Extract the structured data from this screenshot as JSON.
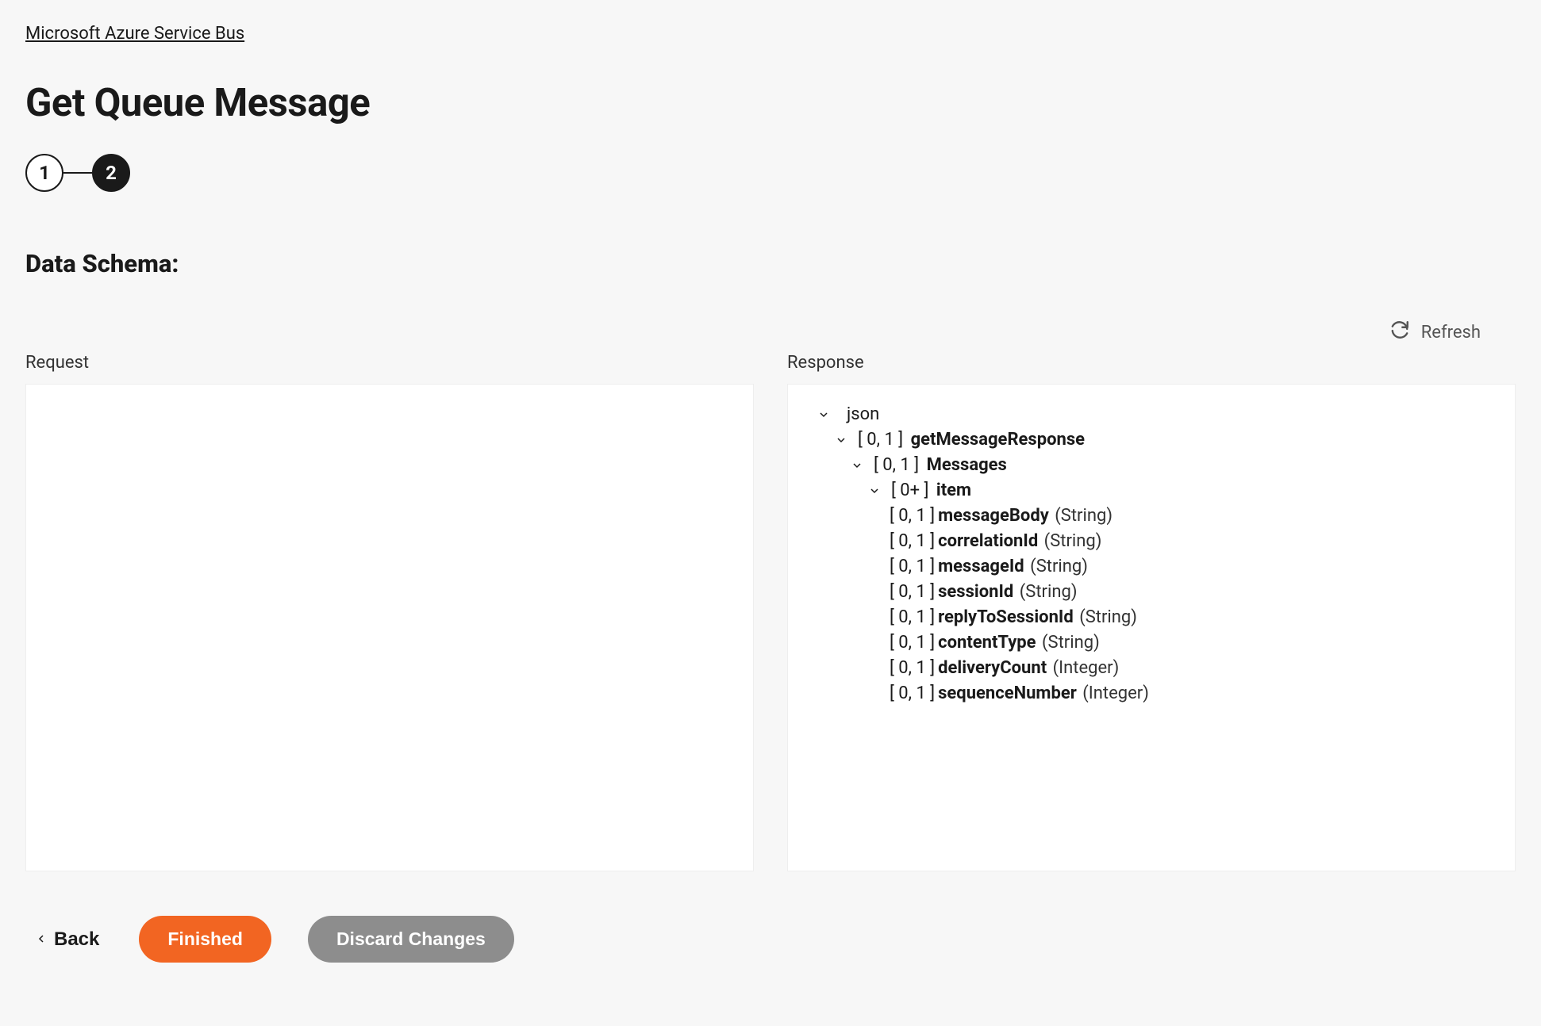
{
  "breadcrumb": "Microsoft Azure Service Bus",
  "page_title": "Get Queue Message",
  "stepper": {
    "step1": "1",
    "step2": "2"
  },
  "section_title": "Data Schema:",
  "refresh_label": "Refresh",
  "columns": {
    "request": "Request",
    "response": "Response"
  },
  "tree": {
    "root": "json",
    "n1": {
      "card": "[ 0, 1 ]",
      "name": "getMessageResponse"
    },
    "n2": {
      "card": "[ 0, 1 ]",
      "name": "Messages"
    },
    "n3": {
      "card": "[ 0+ ]",
      "name": "item"
    },
    "leaves": [
      {
        "card": "[ 0, 1 ]",
        "name": "messageBody",
        "type": "(String)"
      },
      {
        "card": "[ 0, 1 ]",
        "name": "correlationId",
        "type": "(String)"
      },
      {
        "card": "[ 0, 1 ]",
        "name": "messageId",
        "type": "(String)"
      },
      {
        "card": "[ 0, 1 ]",
        "name": "sessionId",
        "type": "(String)"
      },
      {
        "card": "[ 0, 1 ]",
        "name": "replyToSessionId",
        "type": "(String)"
      },
      {
        "card": "[ 0, 1 ]",
        "name": "contentType",
        "type": "(String)"
      },
      {
        "card": "[ 0, 1 ]",
        "name": "deliveryCount",
        "type": "(Integer)"
      },
      {
        "card": "[ 0, 1 ]",
        "name": "sequenceNumber",
        "type": "(Integer)"
      }
    ]
  },
  "actions": {
    "back": "Back",
    "finished": "Finished",
    "discard": "Discard Changes"
  }
}
